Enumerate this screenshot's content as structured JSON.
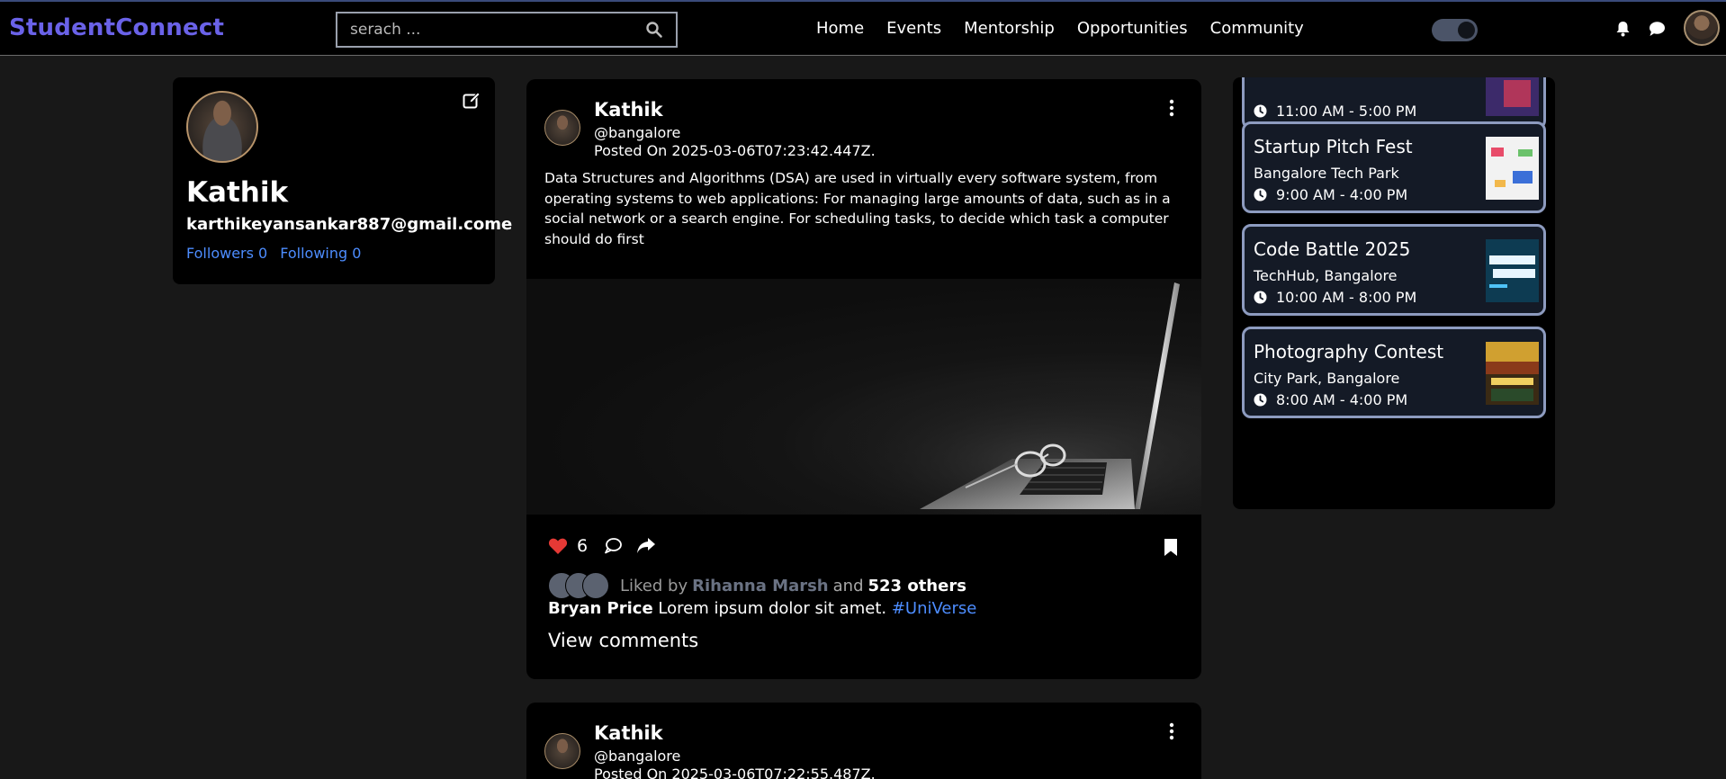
{
  "app": {
    "brand": "StudentConnect"
  },
  "search": {
    "placeholder": "serach ..."
  },
  "nav": {
    "links": [
      "Home",
      "Events",
      "Mentorship",
      "Opportunities",
      "Community"
    ]
  },
  "profile": {
    "name": "Kathik",
    "email": "karthikeyansankar887@gmail.come",
    "followers_label": "Followers 0",
    "following_label": "Following 0"
  },
  "posts": [
    {
      "author": "Kathik",
      "handle": "@bangalore",
      "date": "Posted On 2025-03-06T07:23:42.447Z.",
      "text": "Data Structures and Algorithms (DSA) are used in virtually every software system, from operating systems to web applications: For managing large amounts of data, such as in a social network or a search engine. For scheduling tasks, to decide which task a computer should do first",
      "likes": "6",
      "liked_by_prefix": "Liked by",
      "liked_by_name": "Rihanna Marsh",
      "liked_and": "and",
      "liked_others": "523 others",
      "caption_user": "Bryan Price",
      "caption_text": "Lorem ipsum dolor sit amet.",
      "hashtag": "#UniVerse",
      "view_comments": "View comments"
    },
    {
      "author": "Kathik",
      "handle": "@bangalore",
      "date": "Posted On 2025-03-06T07:22:55.487Z."
    }
  ],
  "events": [
    {
      "title": "",
      "location": "",
      "time": "11:00 AM - 5:00 PM"
    },
    {
      "title": "Startup Pitch Fest",
      "location": "Bangalore Tech Park",
      "time": "9:00 AM - 4:00 PM"
    },
    {
      "title": "Code Battle 2025",
      "location": "TechHub, Bangalore",
      "time": "10:00 AM - 8:00 PM"
    },
    {
      "title": "Photography Contest",
      "location": "City Park, Bangalore",
      "time": "8:00 AM - 4:00 PM"
    }
  ],
  "colors": {
    "brand": "#6a62e8",
    "link": "#4d8dff",
    "heart": "#e53935",
    "event_border": "#8d9bbf"
  }
}
